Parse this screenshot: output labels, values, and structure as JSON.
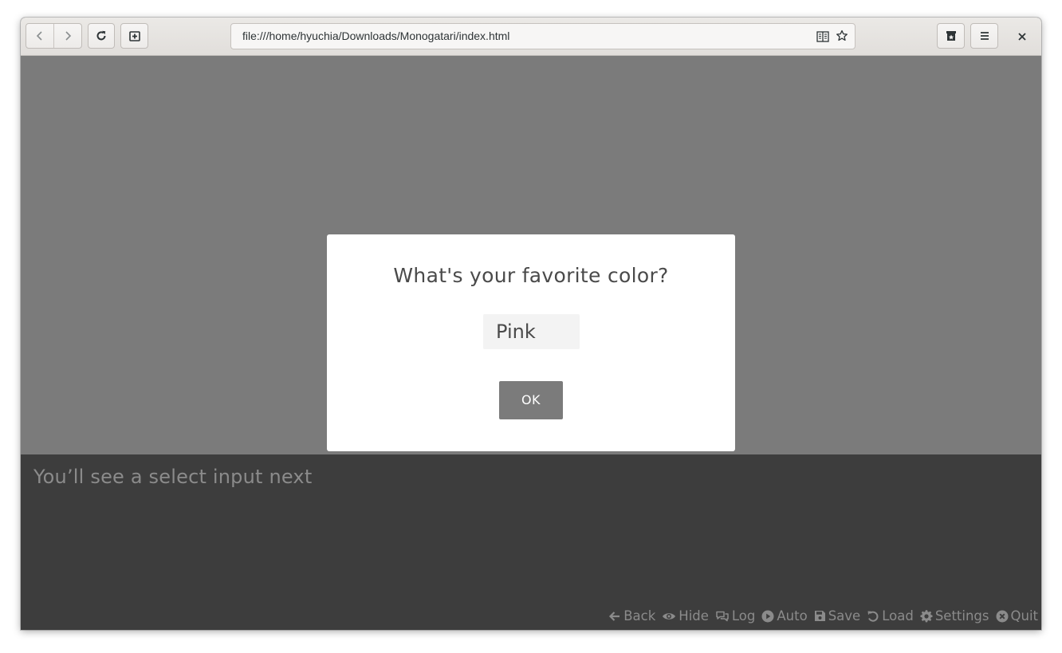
{
  "browser": {
    "url": "file:///home/hyuchia/Downloads/Monogatari/index.html"
  },
  "modal": {
    "question": "What's your favorite color?",
    "selected_option": "Pink",
    "ok_label": "OK"
  },
  "dialog": {
    "text": "You’ll see a select input next"
  },
  "quick_menu": {
    "items": [
      {
        "label": "Back",
        "icon": "arrow-left-icon"
      },
      {
        "label": "Hide",
        "icon": "eye-icon"
      },
      {
        "label": "Log",
        "icon": "chat-bubbles-icon"
      },
      {
        "label": "Auto",
        "icon": "play-circle-icon"
      },
      {
        "label": "Save",
        "icon": "floppy-disk-icon"
      },
      {
        "label": "Load",
        "icon": "undo-icon"
      },
      {
        "label": "Settings",
        "icon": "gear-icon"
      },
      {
        "label": "Quit",
        "icon": "close-circle-icon"
      }
    ]
  },
  "colors": {
    "stage_background": "#7b7b7b",
    "textbox_background": "#3d3d3d",
    "modal_background": "#ffffff",
    "ok_button": "#7b7b7b",
    "muted_text": "#8b8b8b"
  }
}
